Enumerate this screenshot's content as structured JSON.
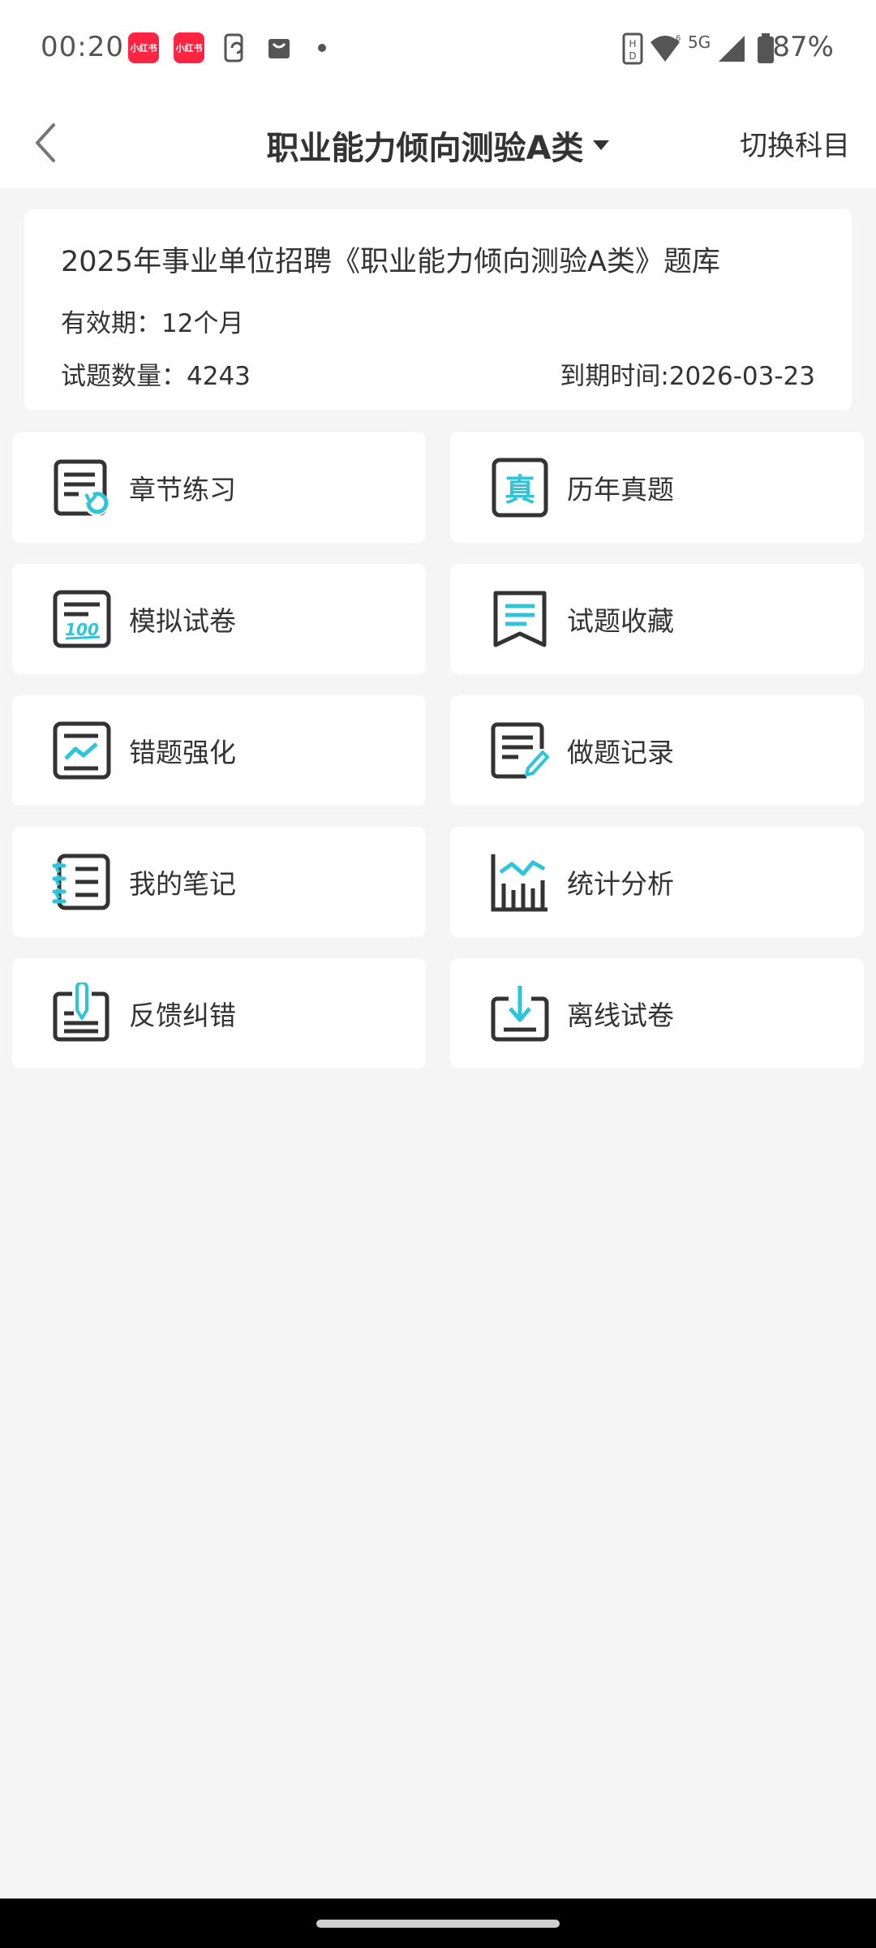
{
  "status_bar": {
    "time": "00:20",
    "battery": "87%",
    "network": "5G",
    "notif_badge": "小红书"
  },
  "header": {
    "title": "职业能力倾向测验A类",
    "switch_label": "切换科目"
  },
  "info_card": {
    "title": "2025年事业单位招聘《职业能力倾向测验A类》题库",
    "validity": "有效期：12个月",
    "question_count": "试题数量：4243",
    "expire_time": "到期时间:2026-03-23"
  },
  "menu": [
    {
      "label": "章节练习",
      "icon": "chapter-practice-icon"
    },
    {
      "label": "历年真题",
      "icon": "past-papers-icon"
    },
    {
      "label": "模拟试卷",
      "icon": "mock-exam-icon"
    },
    {
      "label": "试题收藏",
      "icon": "favorites-icon"
    },
    {
      "label": "错题强化",
      "icon": "wrong-questions-icon"
    },
    {
      "label": "做题记录",
      "icon": "practice-record-icon"
    },
    {
      "label": "我的笔记",
      "icon": "notes-icon"
    },
    {
      "label": "统计分析",
      "icon": "statistics-icon"
    },
    {
      "label": "反馈纠错",
      "icon": "feedback-icon"
    },
    {
      "label": "离线试卷",
      "icon": "offline-download-icon"
    }
  ],
  "colors": {
    "accent": "#2ec4d9",
    "icon_dark": "#333333",
    "background": "#f5f5f5",
    "badge": "#ff2442"
  }
}
